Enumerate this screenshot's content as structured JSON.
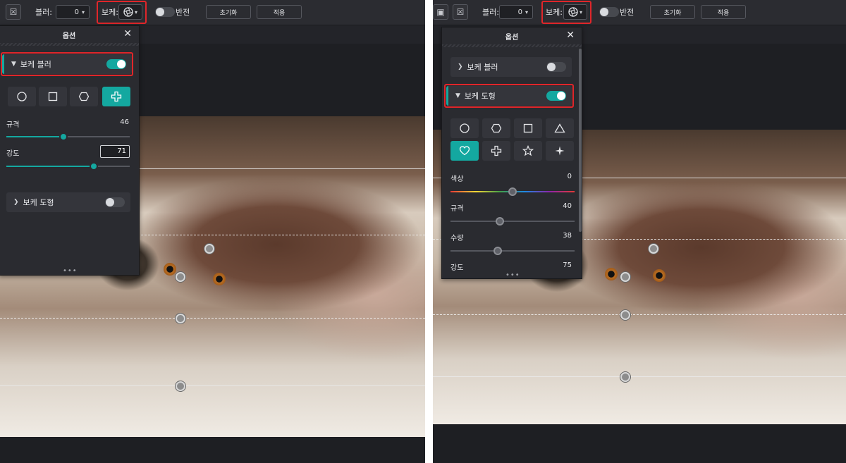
{
  "left": {
    "toolbar": {
      "blur_label": "블러:",
      "blur_value": "0",
      "bokeh_label": "보케:",
      "invert_label": "반전",
      "reset_label": "초기화",
      "apply_label": "적용"
    },
    "panel": {
      "title": "옵션",
      "close_glyph": "✕",
      "section_bokeh_blur": {
        "label": "보케 블러",
        "enabled": true
      },
      "shapes": [
        "circle",
        "square",
        "hexagon",
        "cross"
      ],
      "selected_shape": "cross",
      "scale": {
        "label": "규격",
        "value": "46",
        "fraction": 0.46
      },
      "intensity": {
        "label": "강도",
        "value": "71",
        "fraction": 0.71
      },
      "section_bokeh_shape": {
        "label": "보케 도형",
        "enabled": false
      },
      "more_glyph": "•••"
    }
  },
  "right": {
    "toolbar": {
      "blur_label": "블러:",
      "blur_value": "0",
      "bokeh_label": "보케:",
      "invert_label": "반전",
      "reset_label": "초기화",
      "apply_label": "적용"
    },
    "panel": {
      "title": "옵션",
      "close_glyph": "✕",
      "section_bokeh_blur": {
        "label": "보케 블러",
        "enabled": false
      },
      "section_bokeh_shape": {
        "label": "보케 도형",
        "enabled": true
      },
      "shapes": [
        "circle",
        "hexagon",
        "square",
        "triangle",
        "heart",
        "cross",
        "star",
        "sparkle"
      ],
      "selected_shape": "heart",
      "hue": {
        "label": "색상",
        "value": "0",
        "fraction": 0.5
      },
      "scale": {
        "label": "규격",
        "value": "40",
        "fraction": 0.4
      },
      "amount": {
        "label": "수량",
        "value": "38",
        "fraction": 0.38
      },
      "intensity": {
        "label": "강도",
        "value": "75"
      },
      "more_glyph": "•••"
    }
  },
  "colors": {
    "accent": "#14a8a0",
    "highlight": "#e0262a",
    "panel_bg": "#2a2b30",
    "toolbar_bg": "#2b2c31"
  },
  "icons": {
    "bokeh_aperture": "aperture-icon",
    "dropdown": "chevron-down-icon",
    "toggle": "toggle-switch",
    "close": "close-icon"
  }
}
